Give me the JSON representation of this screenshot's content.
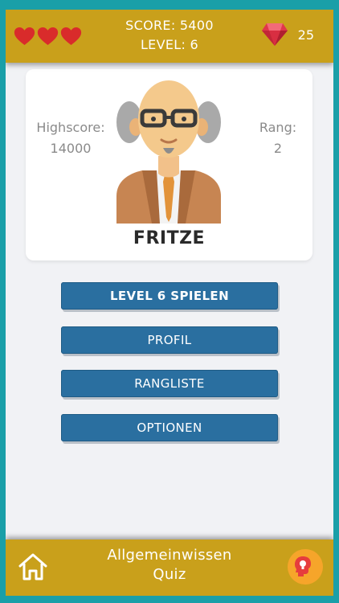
{
  "header": {
    "lives": 3,
    "score_text": "SCORE: 5400",
    "level_text": "LEVEL: 6",
    "gem_count": "25"
  },
  "profile": {
    "highscore_label": "Highscore:",
    "highscore_value": "14000",
    "rank_label": "Rang:",
    "rank_value": "2",
    "name": "FRITZE"
  },
  "menu": {
    "play": "LEVEL 6 SPIELEN",
    "profile": "PROFIL",
    "leaderboard": "RANGLISTE",
    "options": "OPTIONEN"
  },
  "footer": {
    "title_line1": "Allgemeinwissen",
    "title_line2": "Quiz"
  },
  "colors": {
    "header_bar": "#c9a01b",
    "button": "#2a6fa0",
    "heart": "#d92b2b",
    "gem": "#e0374a",
    "frame_border": "#1a9fa8"
  }
}
